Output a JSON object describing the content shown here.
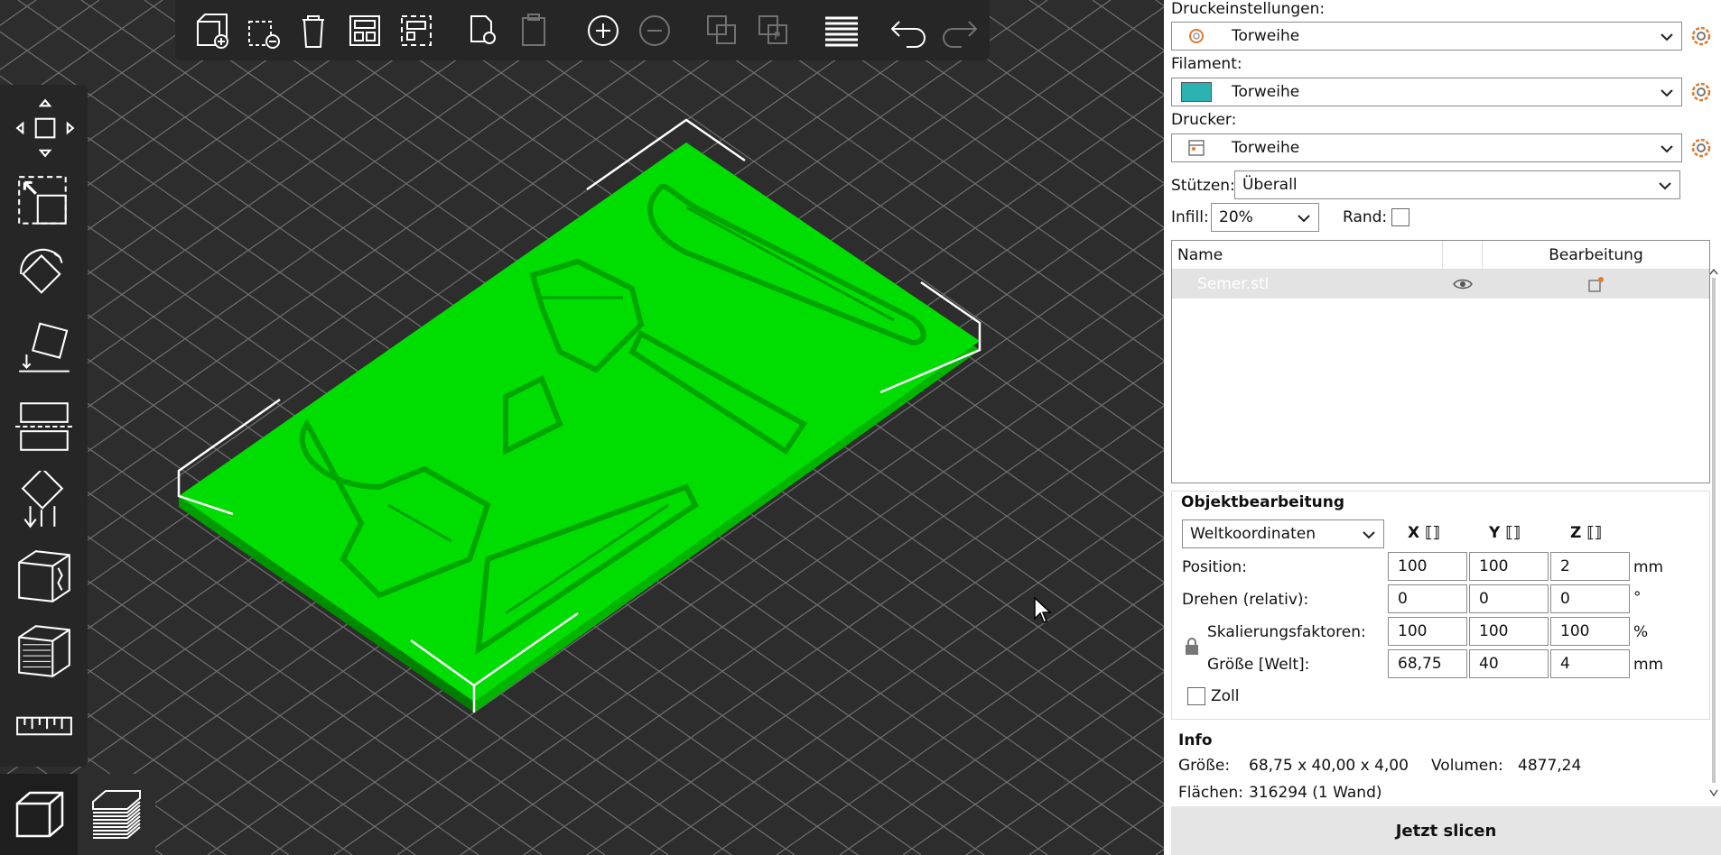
{
  "colors": {
    "model": "#00cc00",
    "grid": "#707070",
    "filament": "#2bb3b3",
    "accent": "#e07a2e"
  },
  "top_toolbar": {
    "icons": [
      "add-object-icon",
      "delete-object-icon",
      "delete-all-icon",
      "arrange-icon",
      "arrange-selection-icon",
      "copy-icon",
      "paste-icon",
      "add-instance-icon",
      "remove-instance-icon",
      "split-objects-icon",
      "split-parts-icon",
      "variable-layer-height-icon",
      "undo-icon",
      "redo-icon"
    ]
  },
  "left_toolbar": {
    "icons": [
      "move-icon",
      "scale-icon",
      "rotate-icon",
      "place-on-face-icon",
      "cut-icon",
      "support-paint-icon",
      "seam-paint-icon",
      "fdm-supports-icon",
      "measure-icon"
    ]
  },
  "panel": {
    "print_settings_label": "Druckeinstellungen:",
    "print_settings_value": "Torweihe",
    "filament_label": "Filament:",
    "filament_value": "Torweihe",
    "printer_label": "Drucker:",
    "printer_value": "Torweihe",
    "supports_label": "Stützen:",
    "supports_value": "Überall",
    "infill_label": "Infill:",
    "infill_value": "20%",
    "brim_label": "Rand:",
    "list": {
      "col_name": "Name",
      "col_edit": "Bearbeitung",
      "rows": [
        {
          "name": "Semer.stl"
        }
      ]
    },
    "object_manipulation": {
      "title": "Objektbearbeitung",
      "coord_system": "Weltkoordinaten",
      "axis_x": "X",
      "axis_y": "Y",
      "axis_z": "Z",
      "position_label": "Position:",
      "position": [
        "100",
        "100",
        "2"
      ],
      "position_unit": "mm",
      "rotate_label": "Drehen (relativ):",
      "rotate": [
        "0",
        "0",
        "0"
      ],
      "rotate_unit": "°",
      "scale_label": "Skalierungsfaktoren:",
      "scale": [
        "100",
        "100",
        "100"
      ],
      "scale_unit": "%",
      "size_label": "Größe [Welt]:",
      "size": [
        "68,75",
        "40",
        "4"
      ],
      "size_unit": "mm",
      "inches_label": "Zoll"
    },
    "info": {
      "title": "Info",
      "size_label": "Größe:",
      "size_value": "68,75 x 40,00 x 4,00",
      "volume_label": "Volumen:",
      "volume_value": "4877,24",
      "facets_label": "Flächen:",
      "facets_value": "316294 (1 Wand)"
    },
    "slice_button": "Jetzt slicen"
  }
}
